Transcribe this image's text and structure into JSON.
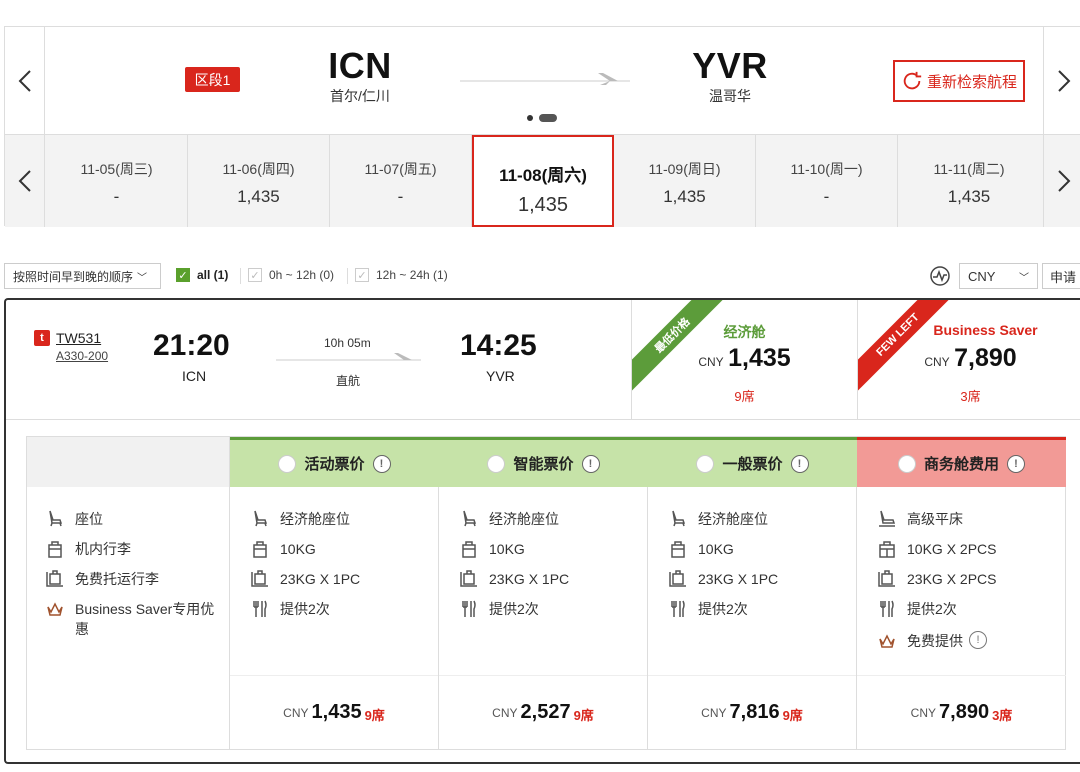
{
  "route": {
    "segment_label": "区段1",
    "from": {
      "code": "ICN",
      "city": "首尔/仁川"
    },
    "to": {
      "code": "YVR",
      "city": "温哥华"
    },
    "research_label": "重新检索航程"
  },
  "dates": [
    {
      "date": "11-05(周三)",
      "price": "-"
    },
    {
      "date": "11-06(周四)",
      "price": "1,435"
    },
    {
      "date": "11-07(周五)",
      "price": "-"
    },
    {
      "date": "11-08(周六)",
      "price": "1,435"
    },
    {
      "date": "11-09(周日)",
      "price": "1,435"
    },
    {
      "date": "11-10(周一)",
      "price": "-"
    },
    {
      "date": "11-11(周二)",
      "price": "1,435"
    }
  ],
  "filters": {
    "sort": "按照时间早到晚的顺序",
    "all": "all (1)",
    "range1": "0h ~ 12h (0)",
    "range2": "12h ~ 24h (1)",
    "currency": "CNY",
    "apply": "申请"
  },
  "flight": {
    "airline_logo": "t",
    "number": "TW531",
    "aircraft": "A330-200",
    "dep_time": "21:20",
    "dep_airport": "ICN",
    "arr_time": "14:25",
    "arr_airport": "YVR",
    "duration": "10h 05m",
    "stops": "直航"
  },
  "cabins": {
    "economy": {
      "ribbon": "最低价格",
      "name": "经济舱",
      "currency": "CNY",
      "price": "1,435",
      "seats": "9席"
    },
    "business": {
      "ribbon": "FEW LEFT",
      "name": "Business Saver",
      "currency": "CNY",
      "price": "7,890",
      "seats": "3席"
    }
  },
  "fare_table": {
    "row_labels": [
      "座位",
      "机内行李",
      "免费托运行李",
      "Business Saver专用优惠"
    ],
    "columns": [
      {
        "name": "活动票价",
        "features": [
          "经济舱座位",
          "10KG",
          "23KG X 1PC",
          "提供2次"
        ],
        "currency": "CNY",
        "price": "1,435",
        "seats": "9席"
      },
      {
        "name": "智能票价",
        "features": [
          "经济舱座位",
          "10KG",
          "23KG X 1PC",
          "提供2次"
        ],
        "currency": "CNY",
        "price": "2,527",
        "seats": "9席"
      },
      {
        "name": "一般票价",
        "features": [
          "经济舱座位",
          "10KG",
          "23KG X 1PC",
          "提供2次"
        ],
        "currency": "CNY",
        "price": "7,816",
        "seats": "9席"
      },
      {
        "name": "商务舱费用",
        "features": [
          "高级平床",
          "10KG X 2PCS",
          "23KG X 2PCS",
          "提供2次",
          "免费提供"
        ],
        "currency": "CNY",
        "price": "7,890",
        "seats": "3席"
      }
    ],
    "info_glyph": "!"
  },
  "colors": {
    "accent": "#d9261c",
    "green": "#5c9c3a",
    "green_header": "#c6e3a8",
    "red_header": "#f29a96"
  }
}
